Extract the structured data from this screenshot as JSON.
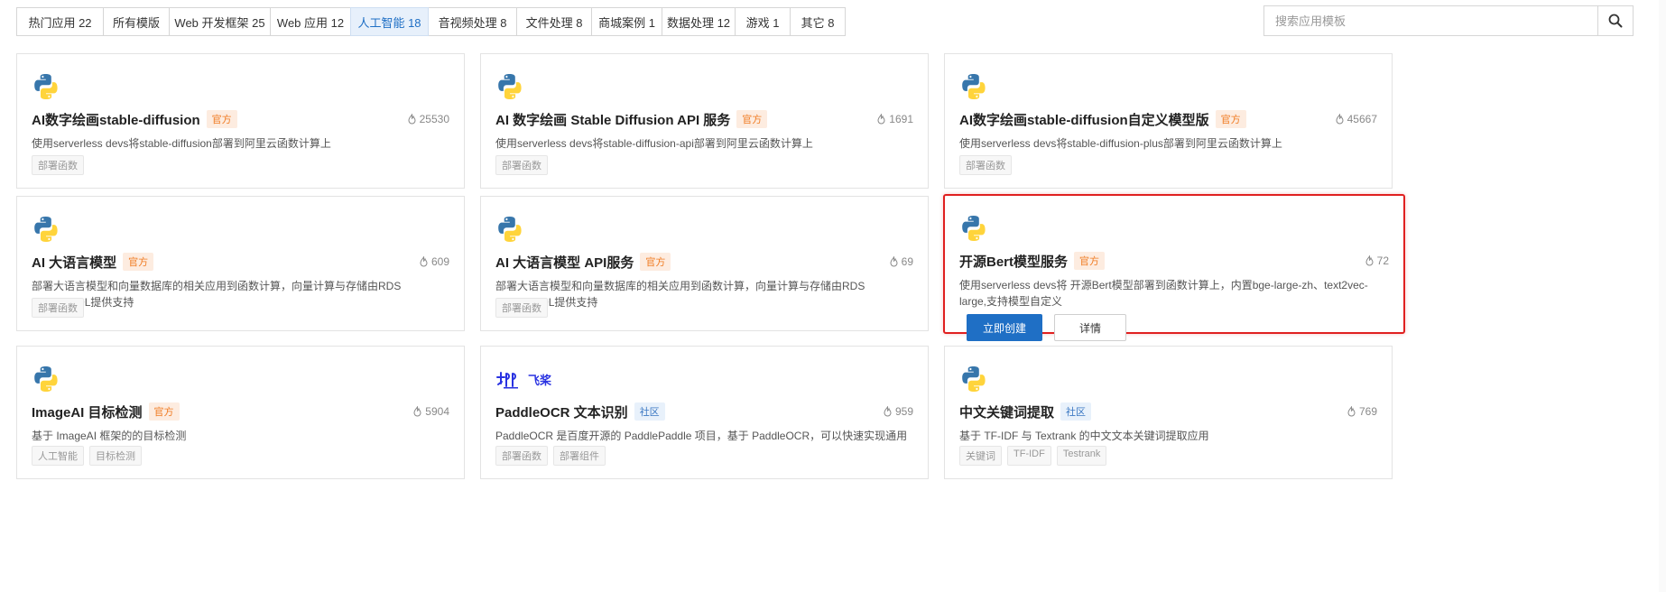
{
  "tabs": [
    {
      "label": "热门应用 22"
    },
    {
      "label": "所有模版"
    },
    {
      "label": "Web 开发框架 25"
    },
    {
      "label": "Web 应用 12"
    },
    {
      "label": "人工智能 18",
      "active": true
    },
    {
      "label": "音视频处理 8"
    },
    {
      "label": "文件处理 8"
    },
    {
      "label": "商城案例 1"
    },
    {
      "label": "数据处理 12"
    },
    {
      "label": "游戏 1"
    },
    {
      "label": "其它 8"
    }
  ],
  "search": {
    "placeholder": "搜索应用模板",
    "icon": "search-icon"
  },
  "colors": {
    "accent": "#1f6fc5",
    "official_badge": "#f07b22",
    "community_badge": "#3b78c3",
    "highlight": "#e02020"
  },
  "cards": [
    {
      "logo": "python-logo",
      "title": "AI数字绘画stable-diffusion",
      "badge": "官方",
      "badge_type": "official",
      "stars": "25530",
      "desc": "使用serverless devs将stable-diffusion部署到阿里云函数计算上",
      "tags": [
        "部署函数"
      ]
    },
    {
      "logo": "python-logo",
      "title": "AI 数字绘画 Stable Diffusion API 服务",
      "badge": "官方",
      "badge_type": "official",
      "stars": "1691",
      "desc": "使用serverless devs将stable-diffusion-api部署到阿里云函数计算上",
      "tags": [
        "部署函数"
      ]
    },
    {
      "logo": "python-logo",
      "title": "AI数字绘画stable-diffusion自定义模型版",
      "badge": "官方",
      "badge_type": "official",
      "stars": "45667",
      "desc": "使用serverless devs将stable-diffusion-plus部署到阿里云函数计算上",
      "tags": [
        "部署函数"
      ]
    },
    {
      "logo": "python-logo",
      "title": "AI 大语言模型",
      "badge": "官方",
      "badge_type": "official",
      "stars": "609",
      "desc": "部署大语言模型和向量数据库的相关应用到函数计算，向量计算与存储由RDS PostgreSQL提供支持",
      "tags": [
        "部署函数"
      ]
    },
    {
      "logo": "python-logo",
      "title": "AI 大语言模型 API服务",
      "badge": "官方",
      "badge_type": "official",
      "stars": "69",
      "desc": "部署大语言模型和向量数据库的相关应用到函数计算，向量计算与存储由RDS PostgreSQL提供支持",
      "tags": [
        "部署函数"
      ]
    },
    {
      "logo": "python-logo",
      "title": "开源Bert模型服务",
      "badge": "官方",
      "badge_type": "official",
      "stars": "72",
      "desc": "使用serverless devs将 开源Bert模型部署到函数计算上，内置bge-large-zh、text2vec-large,支持模型自定义",
      "tags": [],
      "selected": true,
      "create_label": "立即创建",
      "detail_label": "详情"
    },
    {
      "logo": "python-logo",
      "title": "ImageAI 目标检测",
      "badge": "官方",
      "badge_type": "official",
      "stars": "5904",
      "desc": "基于 ImageAI 框架的的目标检测",
      "tags": [
        "人工智能",
        "目标检测"
      ]
    },
    {
      "logo": "paddle-logo",
      "logo_text": "飞桨",
      "title": "PaddleOCR 文本识别",
      "badge": "社区",
      "badge_type": "community",
      "stars": "959",
      "desc": "PaddleOCR 是百度开源的 PaddlePaddle 项目，基于 PaddleOCR，可以快速实现通用 OCR 能力",
      "tags": [
        "部署函数",
        "部署组件"
      ]
    },
    {
      "logo": "python-logo",
      "title": "中文关键词提取",
      "badge": "社区",
      "badge_type": "community",
      "stars": "769",
      "desc": "基于 TF-IDF 与 Textrank 的中文文本关键词提取应用",
      "tags": [
        "关键词",
        "TF-IDF",
        "Testrank"
      ]
    }
  ]
}
